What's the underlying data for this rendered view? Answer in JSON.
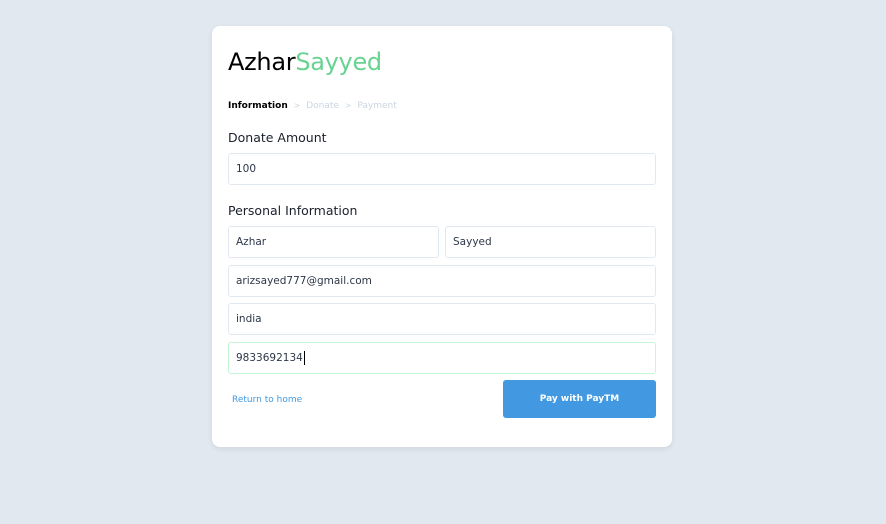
{
  "brand": {
    "first": "Azhar",
    "second": "Sayyed",
    "first_color": "#000000",
    "second_color": "#68d391"
  },
  "breadcrumb": {
    "steps": [
      "Information",
      "Donate",
      "Payment"
    ],
    "separator": ">",
    "active_step": "Information"
  },
  "donate": {
    "label": "Donate Amount",
    "amount_value": "100"
  },
  "personal": {
    "label": "Personal Information",
    "first_name": "Azhar",
    "last_name": "Sayyed",
    "email": "arizsayed777@gmail.com",
    "country": "india",
    "phone": "9833692134"
  },
  "actions": {
    "return_label": "Return to home",
    "pay_label": "Pay with PayTM",
    "pay_color": "#4299e1"
  }
}
